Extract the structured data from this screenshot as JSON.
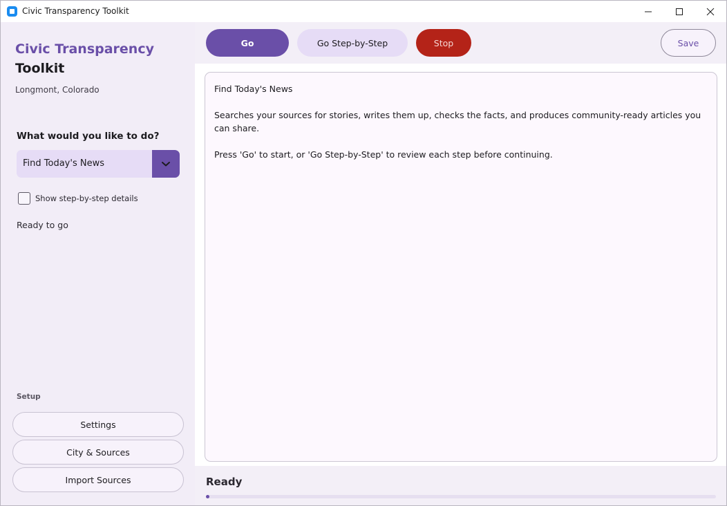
{
  "window": {
    "title": "Civic Transparency Toolkit",
    "minimize_icon": "minimize-icon",
    "maximize_icon": "maximize-icon",
    "close_icon": "close-icon"
  },
  "sidebar": {
    "app_name_line1": "Civic Transparency",
    "app_name_line2": "Toolkit",
    "location": "Longmont, Colorado",
    "prompt": "What would you like to do?",
    "task_select": {
      "value": "Find Today's News",
      "icon": "chevron-down-icon"
    },
    "show_details_label": "Show step-by-step details",
    "show_details_checked": false,
    "status": "Ready to go",
    "setup_label": "Setup",
    "setup_buttons": [
      "Settings",
      "City & Sources",
      "Import Sources"
    ]
  },
  "toolbar": {
    "go_label": "Go",
    "step_label": "Go Step-by-Step",
    "stop_label": "Stop",
    "save_label": "Save"
  },
  "content": {
    "title": "Find Today's News",
    "description": "Searches your sources for stories, writes them up, checks the facts, and produces community-ready articles you can share.",
    "instructions": "Press 'Go' to start, or 'Go Step-by-Step' to review each step before continuing."
  },
  "footer": {
    "status": "Ready",
    "progress": 0.0
  },
  "colors": {
    "accent": "#6a4fa8",
    "accent_light": "#e6dcf6",
    "stop": "#b42318",
    "sidebar_bg": "#f2edf7"
  }
}
